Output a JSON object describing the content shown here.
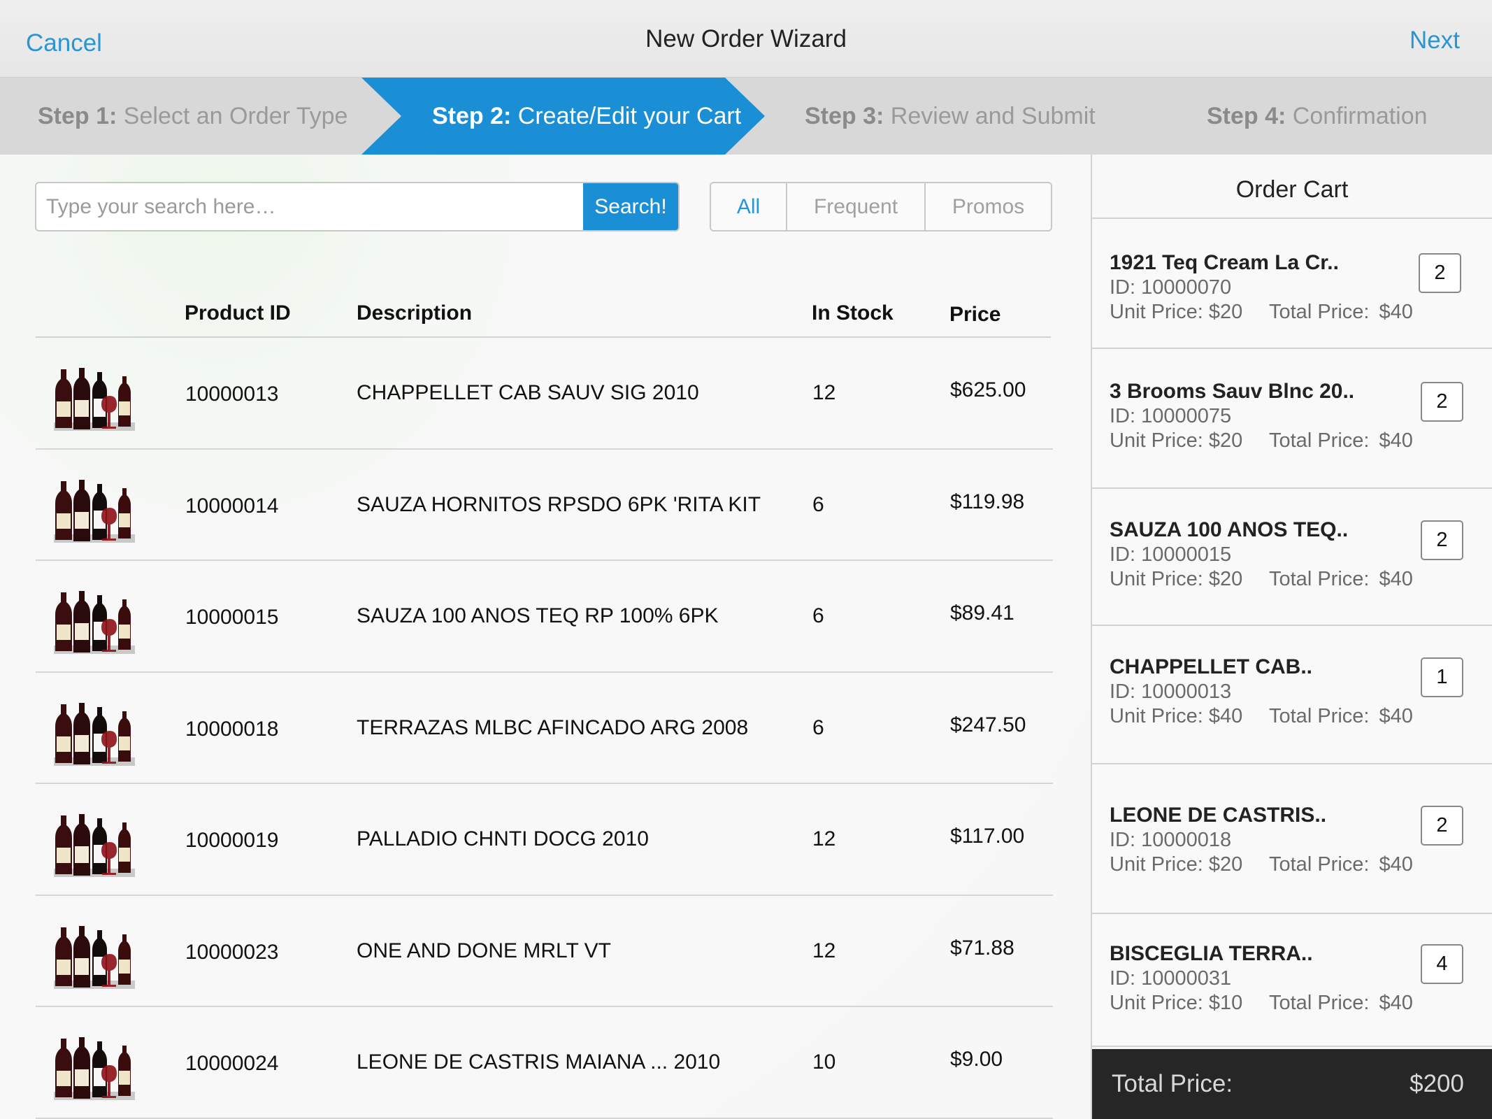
{
  "header": {
    "title": "New Order Wizard",
    "cancel_label": "Cancel",
    "next_label": "Next"
  },
  "steps": [
    {
      "num": "Step 1:",
      "label": " Select an Order Type",
      "active": false
    },
    {
      "num": "Step 2:",
      "label": " Create/Edit your Cart",
      "active": true
    },
    {
      "num": "Step 3:",
      "label": " Review and Submit",
      "active": false
    },
    {
      "num": "Step 4:",
      "label": " Confirmation",
      "active": false
    }
  ],
  "search": {
    "placeholder": "Type your search here…",
    "button_label": "Search!"
  },
  "filters": [
    {
      "label": "All",
      "active": true
    },
    {
      "label": "Frequent",
      "active": false
    },
    {
      "label": "Promos",
      "active": false
    }
  ],
  "table": {
    "columns": [
      "Product ID",
      "Description",
      "In Stock",
      "Price"
    ],
    "rows": [
      {
        "id": "10000013",
        "description": "CHAPPELLET CAB SAUV SIG  2010",
        "stock": "12",
        "price": "$625.00"
      },
      {
        "id": "10000014",
        "description": "SAUZA HORNITOS RPSDO 6PK 'RITA KIT",
        "stock": "6",
        "price": "$119.98"
      },
      {
        "id": "10000015",
        "description": "SAUZA 100 ANOS TEQ RP 100% 6PK",
        "stock": "6",
        "price": "$89.41"
      },
      {
        "id": "10000018",
        "description": "TERRAZAS MLBC AFINCADO ARG  2008",
        "stock": "6",
        "price": "$247.50"
      },
      {
        "id": "10000019",
        "description": "PALLADIO CHNTI DOCG  2010",
        "stock": "12",
        "price": "$117.00"
      },
      {
        "id": "10000023",
        "description": "ONE AND DONE MRLT  VT",
        "stock": "12",
        "price": "$71.88"
      },
      {
        "id": "10000024",
        "description": "LEONE DE CASTRIS MAIANA ...  2010",
        "stock": "10",
        "price": "$9.00"
      }
    ]
  },
  "cart": {
    "title": "Order Cart",
    "items": [
      {
        "name": "1921 Teq Cream La Cr..",
        "id": "ID: 10000070",
        "unit": "Unit Price: $20",
        "total_label": "Total Price:",
        "total": "$40",
        "qty": "2"
      },
      {
        "name": "3 Brooms Sauv Blnc 20..",
        "id": "ID: 10000075",
        "unit": "Unit Price: $20",
        "total_label": "Total Price:",
        "total": "$40",
        "qty": "2"
      },
      {
        "name": "SAUZA 100 ANOS TEQ..",
        "id": "ID: 10000015",
        "unit": "Unit Price: $20",
        "total_label": "Total Price:",
        "total": "$40",
        "qty": "2"
      },
      {
        "name": "CHAPPELLET CAB..",
        "id": "ID: 10000013",
        "unit": "Unit Price: $40",
        "total_label": "Total Price:",
        "total": "$40",
        "qty": "1"
      },
      {
        "name": "LEONE DE CASTRIS..",
        "id": "ID: 10000018",
        "unit": "Unit Price: $20",
        "total_label": "Total Price:",
        "total": "$40",
        "qty": "2"
      },
      {
        "name": "BISCEGLIA TERRA..",
        "id": "ID: 10000031",
        "unit": "Unit Price: $10",
        "total_label": "Total Price:",
        "total": "$40",
        "qty": "4"
      }
    ],
    "total_label": "Total Price:",
    "total_value": "$200"
  },
  "colors": {
    "accent": "#1b8fd6",
    "link": "#2a95d3",
    "cart_total_bg": "#262626"
  },
  "icons": {
    "product_thumbnail": "wine-bottles-icon"
  }
}
